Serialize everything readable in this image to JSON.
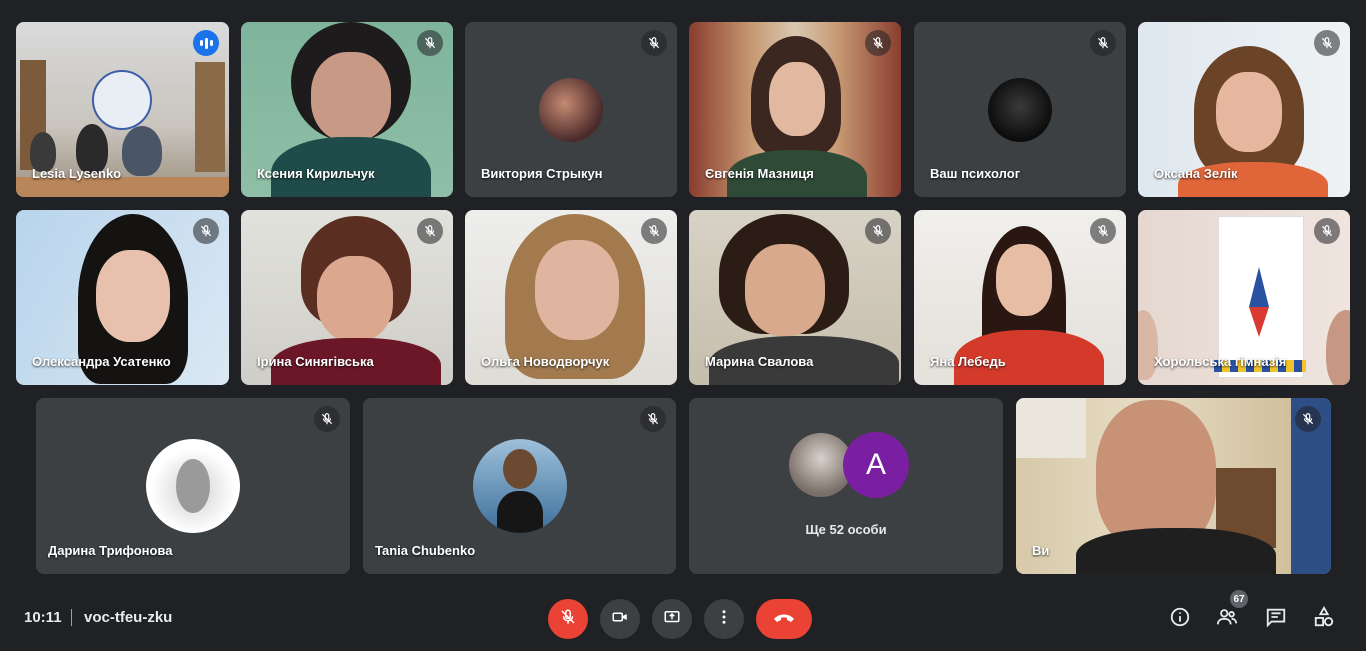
{
  "participants": [
    {
      "name": "Lesia Lysenko",
      "speaking": true
    },
    {
      "name": "Ксения Кирильчук"
    },
    {
      "name": "Виктория Стрыкун"
    },
    {
      "name": "Євгенія Мазниця"
    },
    {
      "name": "Ваш психолог"
    },
    {
      "name": "Оксана Зелік"
    },
    {
      "name": "Олександра Усатенко"
    },
    {
      "name": "Ірина Синягівська"
    },
    {
      "name": "Ольга Новодворчук"
    },
    {
      "name": "Марина Свалова"
    },
    {
      "name": "Яна Лебедь"
    },
    {
      "name": "Хорольська гімназія"
    },
    {
      "name": "Дарина Трифонова"
    },
    {
      "name": "Tania Chubenko"
    },
    {
      "name": "Ви"
    }
  ],
  "more": {
    "label": "Ще 52 особи",
    "avatar_letter": "A",
    "avatar_color": "#7b1fa2"
  },
  "bottombar": {
    "time": "10:11",
    "meeting_code": "voc-tfeu-zku",
    "participant_count": "67"
  },
  "colors": {
    "background": "#202124",
    "tile": "#3c4043",
    "accent": "#8ab4f8",
    "danger": "#ea4335"
  }
}
